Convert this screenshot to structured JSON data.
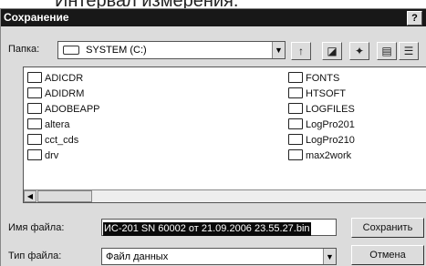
{
  "above_text": "Интервал измерения.",
  "dialog": {
    "title": "Сохранение",
    "help": "?"
  },
  "folder_label": "Папка:",
  "folder_value": "SYSTEM (C:)",
  "files": [
    "ADICDR",
    "ADIDRM",
    "ADOBEAPP",
    "altera",
    "cct_cds",
    "drv",
    "FONTS",
    "HTSOFT",
    "LOGFILES",
    "LogPro201",
    "LogPro210",
    "max2work"
  ],
  "filename_label": "Имя файла:",
  "filename_value": "ИС-201 SN 60002 от 21.09.2006 23.55.27.bin",
  "filetype_label": "Тип файла:",
  "filetype_value": "Файл данных",
  "save_button": "Сохранить",
  "cancel_button": "Отмена"
}
